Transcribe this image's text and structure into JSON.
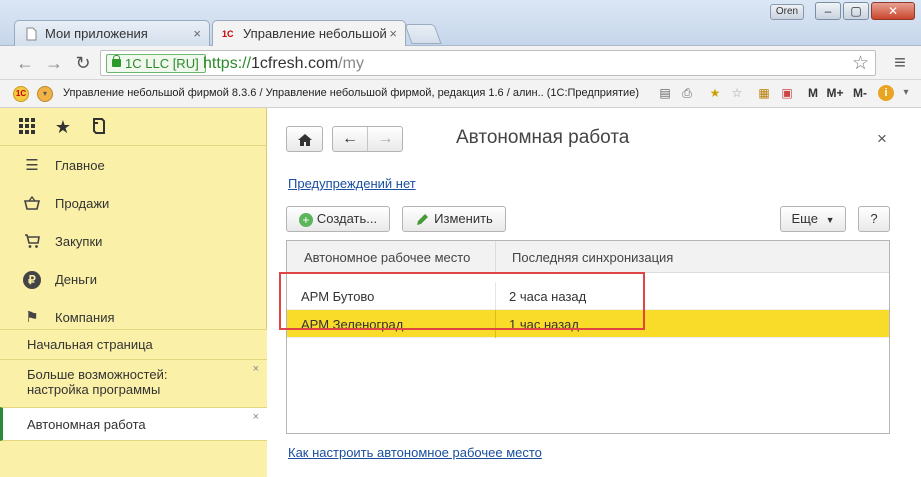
{
  "browser": {
    "tabs": [
      {
        "label": "Мои приложения",
        "close": "×"
      },
      {
        "label": "Управление небольшой",
        "close": "×"
      }
    ],
    "profile": "Oren",
    "window_buttons": {
      "minimize": "‒",
      "maximize": "▢",
      "close": "✕"
    },
    "secure_label": "1C LLC [RU]",
    "url": {
      "scheme": "https://",
      "host": "1cfresh.com",
      "path": "/my"
    },
    "bookmark_title": "Управление небольшой фирмой 8.3.6 / Управление небольшой фирмой, редакция 1.6 / алин.. (1С:Предприятие)",
    "right_icons": {
      "m": "M",
      "m_plus": "M+",
      "m_minus": "M-",
      "info": "i"
    },
    "logo_text": "1C"
  },
  "sidebar": {
    "menu": [
      {
        "label": "Главное",
        "icon": "list-icon"
      },
      {
        "label": "Продажи",
        "icon": "basket-icon"
      },
      {
        "label": "Закупки",
        "icon": "cart-icon"
      },
      {
        "label": "Деньги",
        "icon": "ruble-icon"
      },
      {
        "label": "Компания",
        "icon": "flag-icon"
      }
    ],
    "open_windows": [
      {
        "label": "Начальная страница"
      },
      {
        "label": "Больше возможностей:\nнастройка программы",
        "close": "×"
      },
      {
        "label": "Автономная работа",
        "close": "×"
      }
    ]
  },
  "main": {
    "title": "Автономная работа",
    "close": "×",
    "warnings_link": "Предупреждений нет",
    "create_label": "Создать...",
    "edit_label": "Изменить",
    "more_label": "Еще",
    "help_label": "?",
    "columns": [
      "Автономное рабочее место",
      "Последняя синхронизация"
    ],
    "rows": [
      {
        "place": "АРМ Бутово",
        "sync": "2 часа назад"
      },
      {
        "place": "АРМ Зеленоград",
        "sync": "1 час назад"
      }
    ],
    "bottom_link": "Как настроить автономное рабочее место"
  },
  "colors": {
    "accent": "#f9dc29",
    "sidebar_bg": "#fbf0a8",
    "link": "#1a4fa0",
    "highlight_box": "#e04545",
    "active_marker": "#2a8a3a"
  }
}
